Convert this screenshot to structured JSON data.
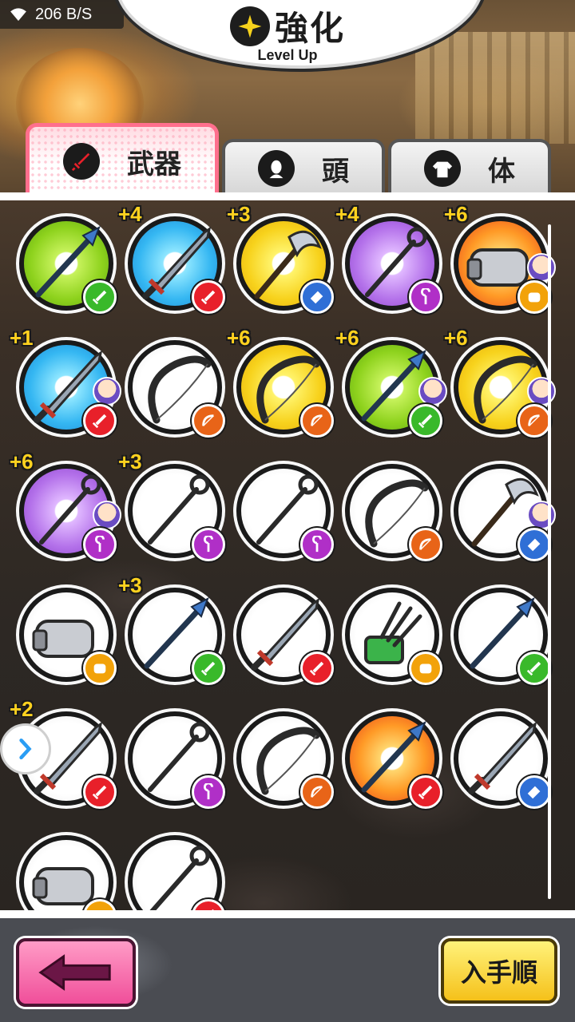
{
  "status_bar": {
    "network_speed": "206 B/S",
    "wifi_icon": "wifi-icon"
  },
  "header": {
    "title": "強化",
    "subtitle": "Level Up",
    "icon": "sparkle-icon"
  },
  "tabs": [
    {
      "label": "武器",
      "icon": "sword-icon",
      "active": true
    },
    {
      "label": "頭",
      "icon": "head-icon",
      "active": false
    },
    {
      "label": "体",
      "icon": "body-icon",
      "active": false
    }
  ],
  "colors": {
    "attr_wind": "#39b92a",
    "attr_fire": "#e8202a",
    "attr_water": "#2f6fd6",
    "attr_dark": "#b02fc7",
    "attr_light": "#f2a20a",
    "attr_bow": "#e86418",
    "active_tab_border": "#ff6f8d",
    "back_button": "#f04f9a",
    "sort_button": "#f5c11a"
  },
  "items": [
    {
      "plus": "",
      "disc": "green",
      "badge": "sword",
      "weapon": "spear"
    },
    {
      "plus": "+4",
      "disc": "blue",
      "badge": "sword-red",
      "weapon": "sword"
    },
    {
      "plus": "+3",
      "disc": "yellow",
      "badge": "hammer-blue",
      "weapon": "axe"
    },
    {
      "plus": "+4",
      "disc": "purple",
      "badge": "staff",
      "weapon": "staff"
    },
    {
      "plus": "+6",
      "disc": "orange",
      "badge": "fist",
      "weapon": "gauntlet",
      "avatar": true
    },
    {
      "plus": "+1",
      "disc": "blue",
      "badge": "sword-red",
      "weapon": "sword",
      "avatar": true
    },
    {
      "plus": "",
      "disc": "white",
      "badge": "bow",
      "weapon": "bow"
    },
    {
      "plus": "+6",
      "disc": "yellow",
      "badge": "bow",
      "weapon": "bow"
    },
    {
      "plus": "+6",
      "disc": "green",
      "badge": "sword",
      "weapon": "spear",
      "avatar": true
    },
    {
      "plus": "+6",
      "disc": "yellow",
      "badge": "bow",
      "weapon": "bow",
      "avatar": true
    },
    {
      "plus": "+6",
      "disc": "purple",
      "badge": "staff",
      "weapon": "staff",
      "avatar": true
    },
    {
      "plus": "+3",
      "disc": "white",
      "badge": "staff",
      "weapon": "staff"
    },
    {
      "plus": "",
      "disc": "white",
      "badge": "staff",
      "weapon": "staff"
    },
    {
      "plus": "",
      "disc": "white",
      "badge": "bow",
      "weapon": "bow"
    },
    {
      "plus": "",
      "disc": "white",
      "badge": "hammer-blue",
      "weapon": "axe",
      "avatar": true
    },
    {
      "plus": "",
      "disc": "white",
      "badge": "fist",
      "weapon": "gauntlet"
    },
    {
      "plus": "+3",
      "disc": "white",
      "badge": "sword",
      "weapon": "spear"
    },
    {
      "plus": "",
      "disc": "white",
      "badge": "sword-red",
      "weapon": "sword"
    },
    {
      "plus": "",
      "disc": "white",
      "badge": "fist",
      "weapon": "claw"
    },
    {
      "plus": "",
      "disc": "white",
      "badge": "sword",
      "weapon": "spear"
    },
    {
      "plus": "+2",
      "disc": "white",
      "badge": "sword-red",
      "weapon": "sword"
    },
    {
      "plus": "",
      "disc": "white",
      "badge": "staff",
      "weapon": "staff"
    },
    {
      "plus": "",
      "disc": "white",
      "badge": "bow",
      "weapon": "bow"
    },
    {
      "plus": "",
      "disc": "orange",
      "badge": "sword-red",
      "weapon": "spear"
    },
    {
      "plus": "",
      "disc": "white",
      "badge": "hammer-blue",
      "weapon": "sword"
    },
    {
      "plus": "",
      "disc": "white",
      "badge": "fist",
      "weapon": "gauntlet"
    },
    {
      "plus": "",
      "disc": "white",
      "badge": "sword-red",
      "weapon": "staff"
    }
  ],
  "footer": {
    "back_icon": "back-arrow-icon",
    "sort_label": "入手順"
  }
}
